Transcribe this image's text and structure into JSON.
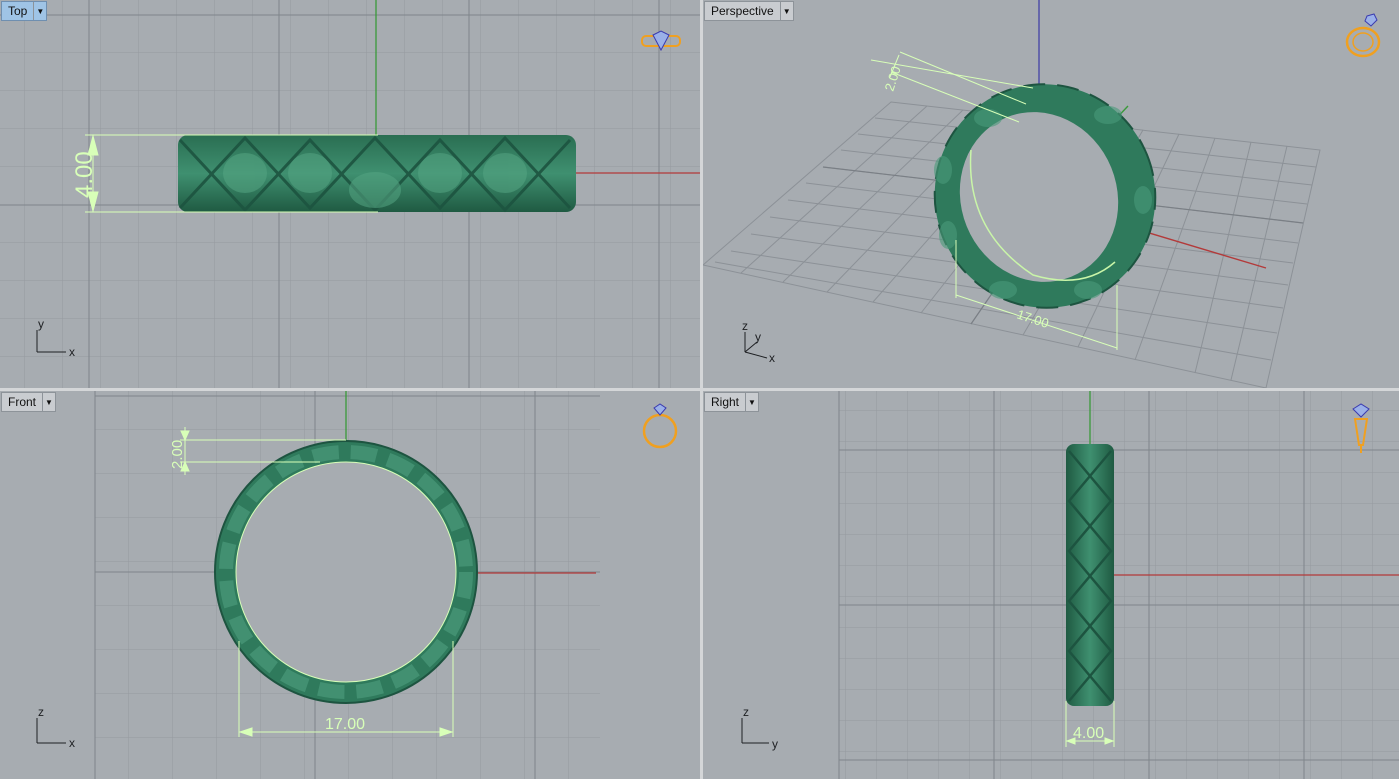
{
  "viewports": {
    "top": {
      "label": "Top",
      "dimension": "4.00",
      "axes": [
        "y",
        "x"
      ]
    },
    "persp": {
      "label": "Perspective",
      "dimension_small": "2.00",
      "dimension_large": "17.00",
      "axes": [
        "z",
        "y",
        "x"
      ]
    },
    "front": {
      "label": "Front",
      "dimension_small": "2.00",
      "dimension_large": "17.00",
      "axes": [
        "z",
        "x"
      ]
    },
    "right": {
      "label": "Right",
      "dimension": "4.00",
      "axes": [
        "z",
        "y"
      ]
    }
  },
  "icons": [
    "ring-top-icon",
    "ring-perspective-icon",
    "ring-front-icon",
    "ring-side-icon"
  ],
  "colors": {
    "viewport_bg": "#a7acb1",
    "grid": "#959aa0",
    "grid_major": "#7f858b",
    "ring": "#2f7a5c",
    "dimension": "#d8ffb8",
    "x_axis": "#b33a3a",
    "y_axis": "#3a9a3a",
    "z_axis": "#4a4aa8",
    "icon": "#f0a020"
  }
}
